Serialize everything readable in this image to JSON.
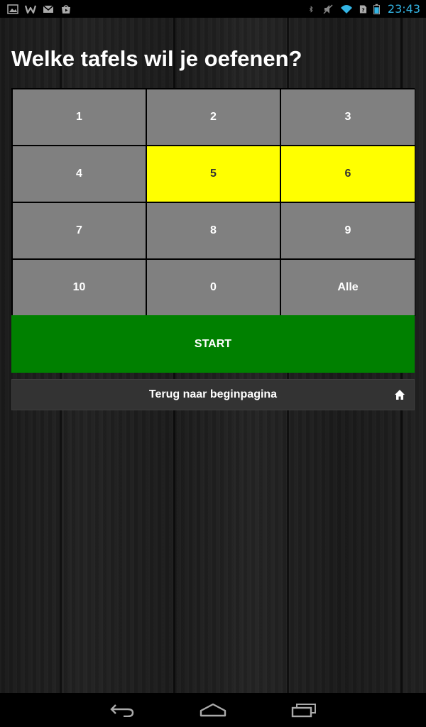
{
  "status_bar": {
    "time": "23:43",
    "left_icons": [
      "image-icon",
      "w-app-icon",
      "gmail-icon",
      "play-store-icon"
    ],
    "right_icons": [
      "bluetooth-icon",
      "mute-icon",
      "wifi-icon",
      "sim-icon",
      "battery-icon"
    ],
    "time_color": "#33b5e5"
  },
  "page": {
    "title": "Welke tafels wil je oefenen?"
  },
  "tables": {
    "cells": [
      {
        "label": "1",
        "selected": false
      },
      {
        "label": "2",
        "selected": false
      },
      {
        "label": "3",
        "selected": false
      },
      {
        "label": "4",
        "selected": false
      },
      {
        "label": "5",
        "selected": true
      },
      {
        "label": "6",
        "selected": true
      },
      {
        "label": "7",
        "selected": false
      },
      {
        "label": "8",
        "selected": false
      },
      {
        "label": "9",
        "selected": false
      },
      {
        "label": "10",
        "selected": false
      },
      {
        "label": "0",
        "selected": false
      },
      {
        "label": "Alle",
        "selected": false
      }
    ],
    "colors": {
      "default": "#808080",
      "selected": "#ffff00"
    }
  },
  "start": {
    "label": "START",
    "color": "#008000"
  },
  "back": {
    "label": "Terug naar beginpagina",
    "icon": "home-icon"
  },
  "nav_bar": {
    "buttons": [
      "back-icon",
      "home-icon",
      "recent-apps-icon"
    ]
  }
}
